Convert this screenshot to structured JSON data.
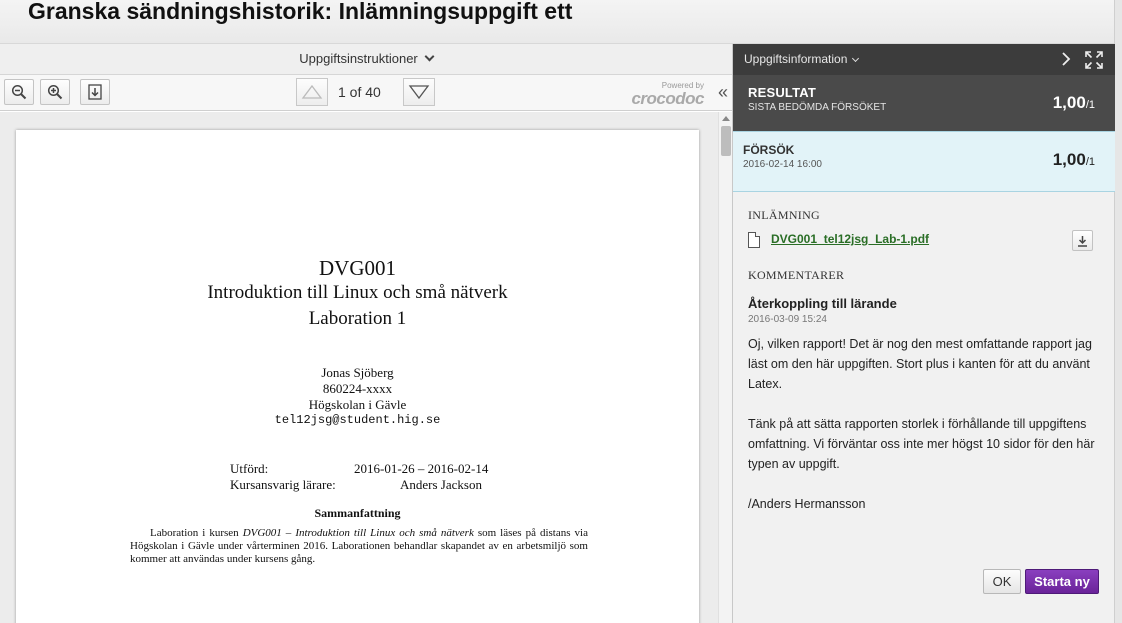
{
  "window": {
    "title": "Granska sändningshistorik: Inlämningsuppgift ett"
  },
  "viewer": {
    "instructions_label": "Uppgiftsinstruktioner",
    "page_indicator": "1 of 40",
    "powered_by_small": "Powered by",
    "powered_by_brand": "crocodoc",
    "collapse_glyph": "«",
    "icons": [
      "zoom-out-icon",
      "zoom-in-icon",
      "download-icon",
      "prev-page-icon",
      "next-page-icon"
    ]
  },
  "document": {
    "course_code": "DVG001",
    "course_name": "Introduktion till Linux och små nätverk",
    "lab": "Laboration 1",
    "author": "Jonas Sjöberg",
    "personal_id": "860224-xxxx",
    "school": "Högskolan i Gävle",
    "email": "tel12jsg@student.hig.se",
    "performed_label": "Utförd:",
    "performed_value": "2016-01-26 – 2016-02-14",
    "teacher_label": "Kursansvarig lärare:",
    "teacher_value": "Anders Jackson",
    "abstract_title": "Sammanfattning",
    "abstract_pre": "Laboration i kursen ",
    "abstract_italic": "DVG001 – Introduktion till Linux och små nätverk",
    "abstract_post": " som läses på distans via Högskolan i Gävle under vårterminen 2016. Laborationen behandlar skapandet av en arbetsmiljö som kommer att användas under kursens gång."
  },
  "panel": {
    "header_label": "Uppgiftsinformation",
    "result": {
      "title": "RESULTAT",
      "subtitle": "SISTA BEDÖMDA FÖRSÖKET",
      "grade": "1,00",
      "grade_den": "/1"
    },
    "attempt": {
      "title": "FÖRSÖK",
      "date": "2016-02-14 16:00",
      "grade": "1,00",
      "grade_den": "/1"
    },
    "submission_heading": "INLÄMNING",
    "file_name": "DVG001_tel12jsg_Lab-1.pdf",
    "comments_heading": "KOMMENTARER",
    "feedback_title": "Återkoppling till lärande",
    "feedback_date": "2016-03-09 15:24",
    "feedback_p1": "Oj, vilken rapport! Det är nog den mest omfattande rapport jag läst om den här uppgiften. Stort plus i kanten för att du använt Latex.",
    "feedback_p2": "Tänk på att sätta rapporten storlek i förhållande till uppgiftens omfattning. Vi förväntar oss inte mer högst 10 sidor för den här typen av uppgift.",
    "feedback_sign": "/Anders Hermansson",
    "ok_label": "OK",
    "start_new_label": "Starta ny"
  },
  "colors": {
    "panel_header": "#3c3c3c",
    "result_bg": "#4a4a4a",
    "attempt_bg": "#e2f3f8",
    "file_link": "#2a6e26",
    "primary_button": "#6a2399"
  }
}
